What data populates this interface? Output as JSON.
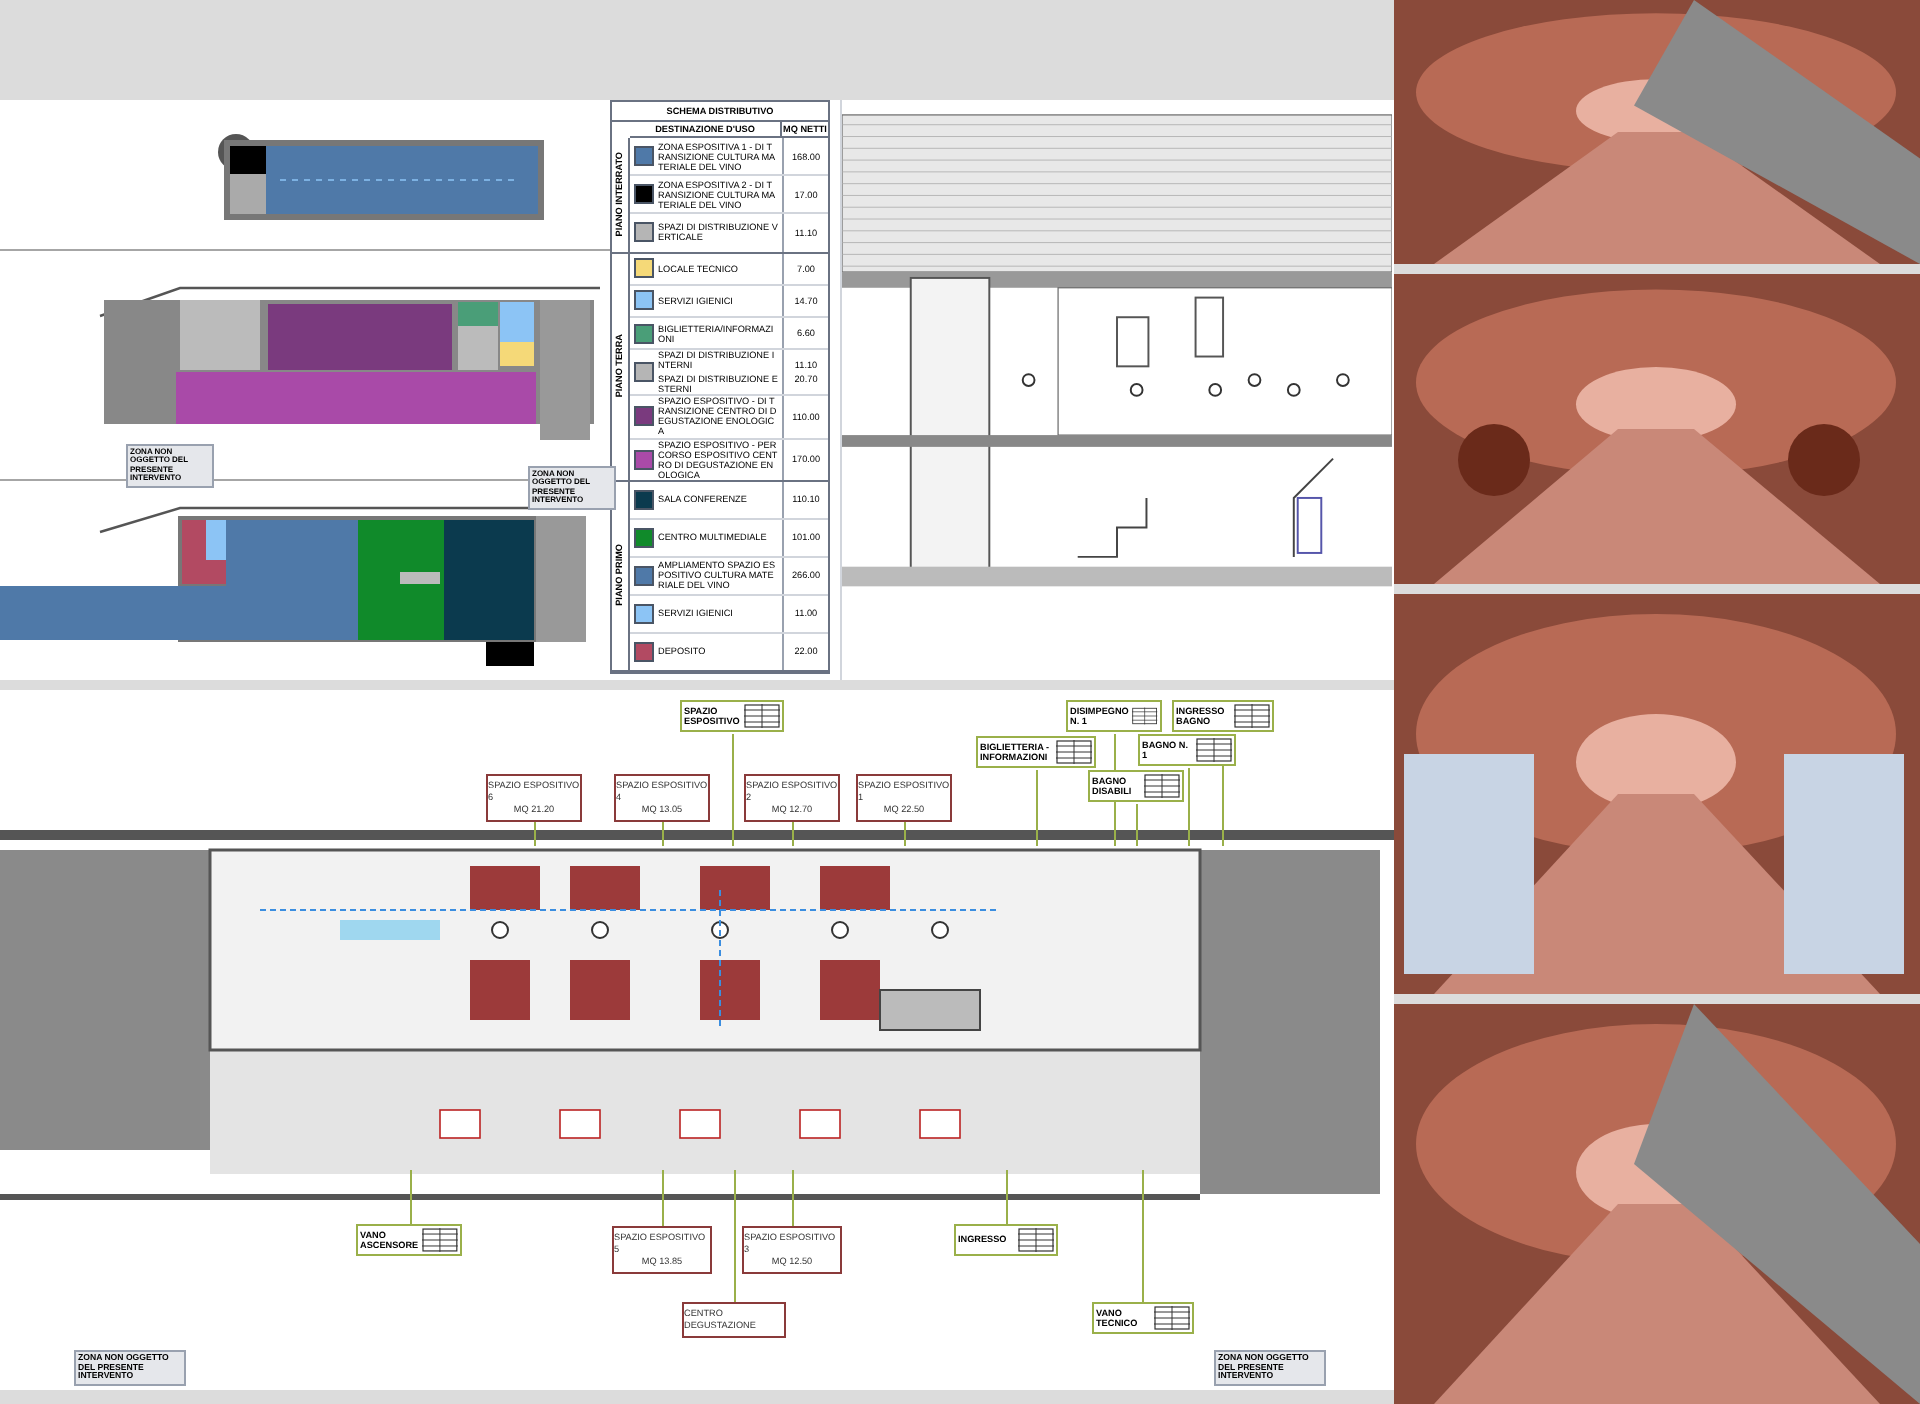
{
  "legend": {
    "title": "SCHEMA DISTRIBUTIVO",
    "columns": [
      "DESTINAZIONE D'USO",
      "MQ NETTI"
    ],
    "groups": [
      {
        "level": "PIANO INTERRATO",
        "rows": [
          {
            "labels": [
              "ZONA ESPOSITIVA 1 - DI TRANSIZIONE CULTURA MATERIALE DEL VINO"
            ],
            "areas": [
              "168.00"
            ],
            "color": "#4f79a8"
          },
          {
            "labels": [
              "ZONA ESPOSITIVA 2 - DI TRANSIZIONE CULTURA MATERIALE DEL VINO"
            ],
            "areas": [
              "17.00"
            ],
            "color": "#000000"
          },
          {
            "labels": [
              "SPAZI DI DISTRIBUZIONE VERTICALE"
            ],
            "areas": [
              "11.10"
            ],
            "color": "#b5b5b5"
          }
        ]
      },
      {
        "level": "PIANO TERRA",
        "rows": [
          {
            "labels": [
              "LOCALE TECNICO"
            ],
            "areas": [
              "7.00"
            ],
            "color": "#f5d978"
          },
          {
            "labels": [
              "SERVIZI IGIENICI"
            ],
            "areas": [
              "14.70"
            ],
            "color": "#8cc4f5"
          },
          {
            "labels": [
              "BIGLIETTERIA/INFORMAZIONI"
            ],
            "areas": [
              "6.60"
            ],
            "color": "#4a9e78"
          },
          {
            "labels": [
              "SPAZI DI DISTRIBUZIONE INTERNI",
              "SPAZI DI DISTRIBUZIONE ESTERNI"
            ],
            "areas": [
              "11.10",
              "20.70"
            ],
            "color": "#b5b5b5"
          },
          {
            "labels": [
              "SPAZIO ESPOSITIVO - DI TRANSIZIONE CENTRO DI DEGUSTAZIONE ENOLOGICA"
            ],
            "areas": [
              "110.00"
            ],
            "color": "#7a3a7e"
          },
          {
            "labels": [
              "SPAZIO ESPOSITIVO - PERCORSO ESPOSITIVO CENTRO DI DEGUSTAZIONE ENOLOGICA"
            ],
            "areas": [
              "170.00"
            ],
            "color": "#a94aa8"
          }
        ]
      },
      {
        "level": "PIANO PRIMO",
        "rows": [
          {
            "labels": [
              "SALA CONFERENZE"
            ],
            "areas": [
              "110.10"
            ],
            "color": "#0b3a4e"
          },
          {
            "labels": [
              "CENTRO MULTIMEDIALE"
            ],
            "areas": [
              "101.00"
            ],
            "color": "#108a2a"
          },
          {
            "labels": [
              "AMPLIAMENTO SPAZIO ESPOSITIVO CULTURA MATERIALE DEL VINO"
            ],
            "areas": [
              "266.00"
            ],
            "color": "#4f79a8"
          },
          {
            "labels": [
              "SERVIZI IGIENICI"
            ],
            "areas": [
              "11.00"
            ],
            "color": "#8cc4f5"
          },
          {
            "labels": [
              "DEPOSITO"
            ],
            "areas": [
              "22.00"
            ],
            "color": "#b24a62"
          }
        ]
      }
    ]
  },
  "key_plans": {
    "notes": [
      "ZONA NON OGGETTO DEL PRESENTE INTERVENTO",
      "ZONA NON OGGETTO DEL PRESENTE INTERVENTO"
    ]
  },
  "ground_floor_plan": {
    "labels": [
      {
        "kind": "room",
        "lines": [
          "SPAZIO ESPOSITIVO 6",
          "MQ 21.20"
        ]
      },
      {
        "kind": "room",
        "lines": [
          "SPAZIO ESPOSITIVO 4",
          "MQ 13.05"
        ]
      },
      {
        "kind": "room",
        "lines": [
          "SPAZIO ESPOSITIVO 2",
          "MQ 12.70"
        ]
      },
      {
        "kind": "room",
        "lines": [
          "SPAZIO ESPOSITIVO 1",
          "MQ 22.50"
        ]
      },
      {
        "kind": "tag",
        "lines": [
          "SPAZIO ESPOSITIVO"
        ]
      },
      {
        "kind": "tag",
        "lines": [
          "BIGLIETTERIA - INFORMAZIONI"
        ]
      },
      {
        "kind": "tag",
        "lines": [
          "DISIMPEGNO N. 1"
        ]
      },
      {
        "kind": "tag",
        "lines": [
          "INGRESSO BAGNO"
        ]
      },
      {
        "kind": "tag",
        "lines": [
          "BAGNO N. 1"
        ]
      },
      {
        "kind": "tag",
        "lines": [
          "BAGNO DISABILI"
        ]
      },
      {
        "kind": "tag",
        "lines": [
          "VANO ASCENSORE"
        ]
      },
      {
        "kind": "room",
        "lines": [
          "SPAZIO ESPOSITIVO 5",
          "MQ 13.85"
        ]
      },
      {
        "kind": "room",
        "lines": [
          "SPAZIO ESPOSITIVO 3",
          "MQ 12.50"
        ]
      },
      {
        "kind": "tag",
        "lines": [
          "INGRESSO"
        ]
      },
      {
        "kind": "room",
        "lines": [
          "CENTRO DEGUSTAZIONE"
        ]
      },
      {
        "kind": "tag",
        "lines": [
          "VANO TECNICO"
        ]
      }
    ],
    "notes": [
      "ZONA NON OGGETTO DEL PRESENTE INTERVENTO",
      "ZONA NON OGGETTO DEL PRESENTE INTERVENTO"
    ]
  }
}
